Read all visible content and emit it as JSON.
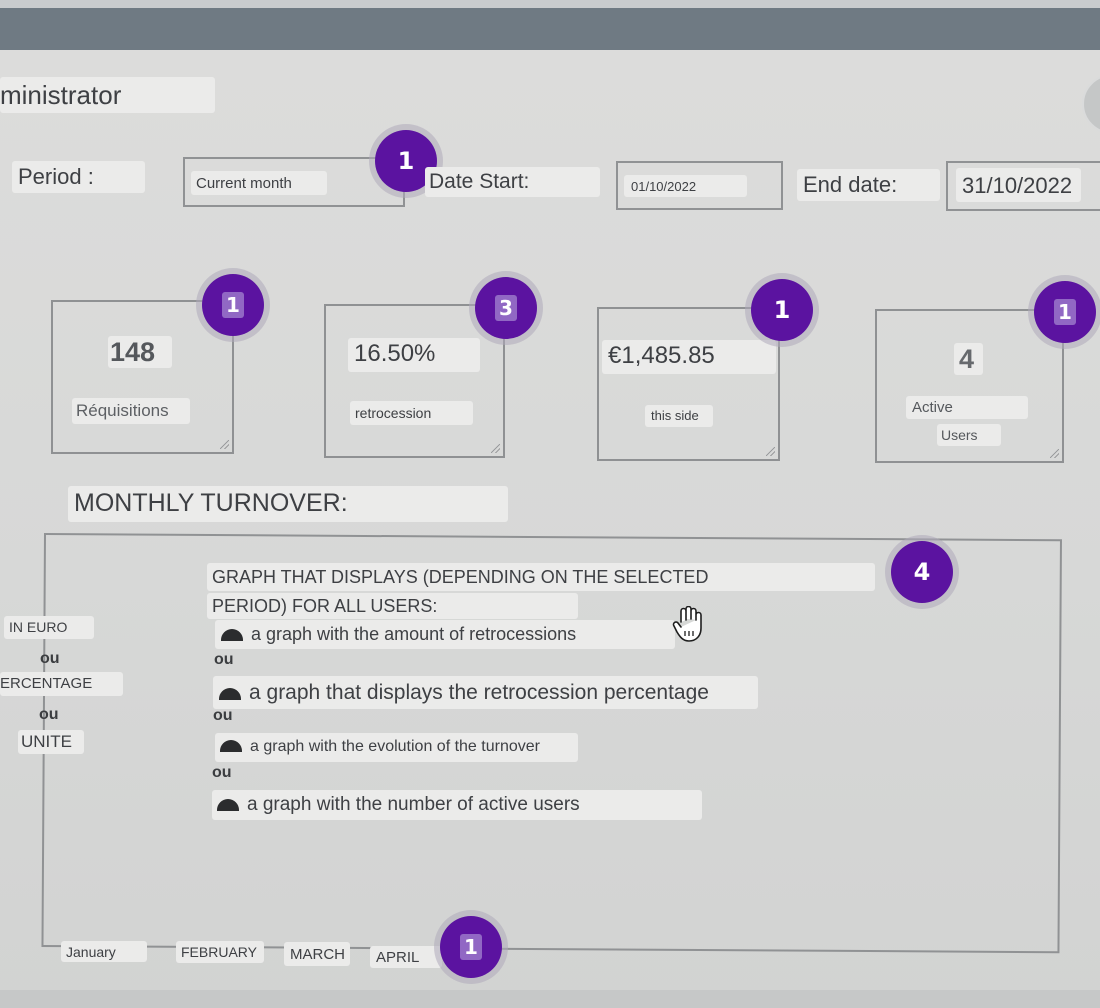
{
  "header": {
    "role_label": "ministrator"
  },
  "filters": {
    "period_label": "Period :",
    "period_value": "Current month",
    "date_start_label": "Date Start:",
    "date_start_value": "01/10/2022",
    "end_date_label": "End date:",
    "end_date_value": "31/10/2022",
    "period_badge": "1"
  },
  "stats": [
    {
      "value": "148",
      "label": "Réquisitions",
      "label2": "",
      "badge": "1"
    },
    {
      "value": "16.50%",
      "label": "retrocession",
      "label2": "",
      "badge": "3"
    },
    {
      "value": "€1,485.85",
      "label": "this side",
      "label2": "",
      "badge": "1"
    },
    {
      "value": "4",
      "label": "Active",
      "label2": "Users",
      "badge": "1"
    }
  ],
  "turnover": {
    "title": "MONTHLY TURNOVER:",
    "badge": "4",
    "units": [
      "IN EURO",
      "ERCENTAGE",
      "UNITE"
    ],
    "unit_separator": "ou",
    "description_line1": "GRAPH THAT DISPLAYS (DEPENDING ON THE SELECTED",
    "description_line2": "PERIOD) FOR ALL USERS:",
    "options": [
      "a graph with the amount of retrocessions",
      "a graph that displays the retrocession percentage",
      "a graph with the evolution of the turnover",
      "a graph with the number of active users"
    ],
    "option_separator": "ou"
  },
  "months": {
    "items": [
      "January",
      "FEBRUARY",
      "MARCH",
      "APRIL"
    ],
    "badge": "1"
  },
  "colors": {
    "badge": "#5b13a0",
    "badge_square": "#9168c4",
    "background": "#d7d8d7",
    "header_bar": "#6f7a83"
  },
  "icons": {
    "badge": "number-badge-icon",
    "bullet": "radio-dot-icon",
    "cursor": "hand-cursor-icon"
  }
}
